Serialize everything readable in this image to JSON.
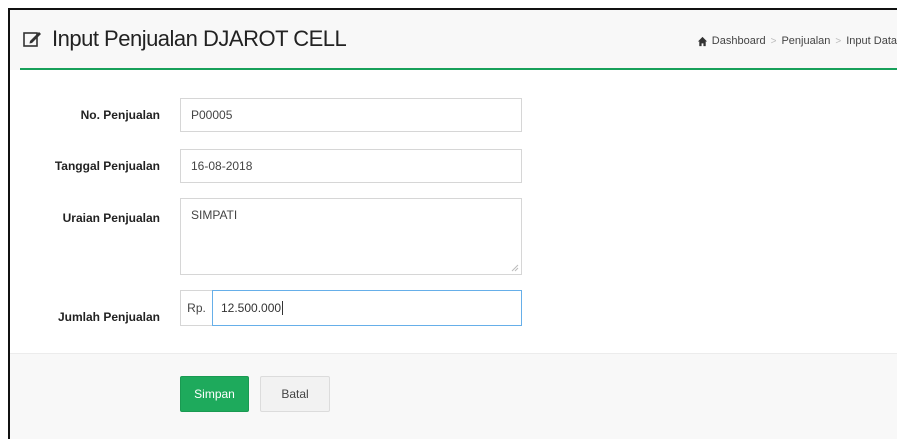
{
  "header": {
    "title": "Input Penjualan DJAROT CELL",
    "title_icon": "edit-icon",
    "accent_color": "#18a05a",
    "breadcrumb": {
      "home_icon": "home-icon",
      "items": [
        "Dashboard",
        "Penjualan",
        "Input Data"
      ]
    }
  },
  "form": {
    "no_penjualan": {
      "label": "No. Penjualan",
      "value": "P00005"
    },
    "tanggal": {
      "label": "Tanggal Penjualan",
      "value": "16-08-2018"
    },
    "uraian": {
      "label": "Uraian Penjualan",
      "value": "SIMPATI"
    },
    "jumlah": {
      "label": "Jumlah Penjualan",
      "prefix": "Rp.",
      "value": "12.500.000"
    }
  },
  "actions": {
    "save_label": "Simpan",
    "save_color": "#1eaa5c",
    "cancel_label": "Batal"
  }
}
